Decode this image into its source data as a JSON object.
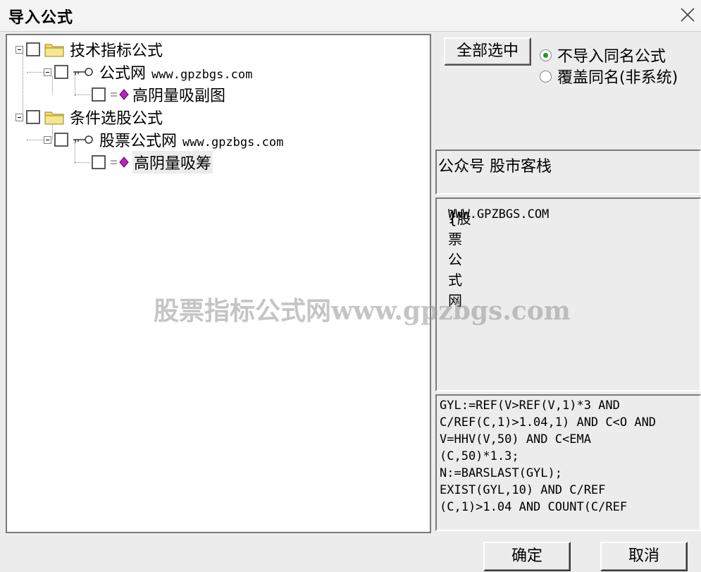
{
  "window": {
    "title": "导入公式"
  },
  "tree": [
    {
      "label": "技术指标公式",
      "url": ""
    },
    {
      "label": "公式网",
      "url": "www.gpzbgs.com"
    },
    {
      "label": "高阴量吸副图",
      "url": ""
    },
    {
      "label": "条件选股公式",
      "url": ""
    },
    {
      "label": "股票公式网",
      "url": "www.gpzbgs.com"
    },
    {
      "label": "高阴量吸筹",
      "url": ""
    }
  ],
  "options": {
    "select_all": "全部选中",
    "radio_skip": "不导入同名公式",
    "radio_overwrite": "覆盖同名(非系统)"
  },
  "author": "公众号 股市客栈",
  "description": {
    "prefix": "{股票公式网 ",
    "url": "WWW.GPZBGS.COM",
    "suffix": "}"
  },
  "code_lines": [
    "GYL:=REF(V>REF(V,1)*3 AND",
    "C/REF(C,1)>1.04,1) AND C<O AND",
    "V=HHV(V,50) AND C<EMA",
    "(C,50)*1.3;",
    "N:=BARSLAST(GYL);",
    "EXIST(GYL,10) AND  C/REF",
    "(C,1)>1.04 AND COUNT(C/REF"
  ],
  "buttons": {
    "ok": "确定",
    "cancel": "取消"
  },
  "watermark": "股票指标公式网www.gpzbgs.com",
  "colors": {
    "radio_selected": "#1a9a1a",
    "gem_icon": "#c020c0",
    "folder_icon": "#f2d96a"
  }
}
